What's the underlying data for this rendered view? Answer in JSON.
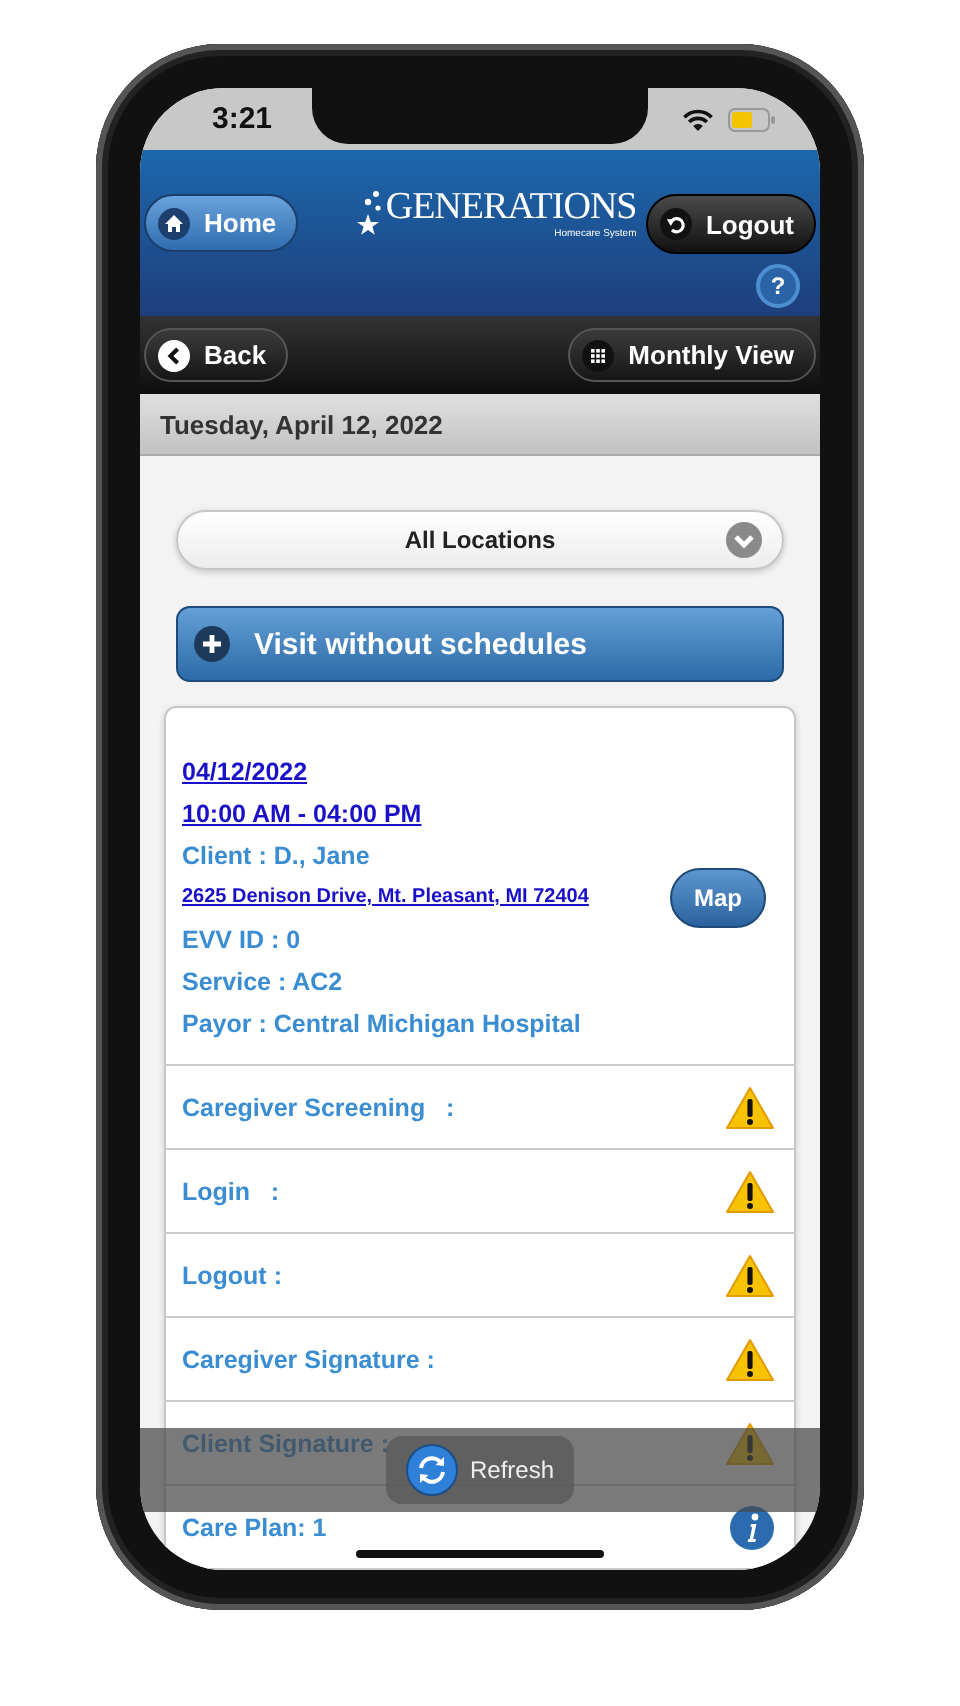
{
  "status_bar": {
    "time": "3:21"
  },
  "header": {
    "home_button": "Home",
    "logo": {
      "name": "GENERATIONS",
      "tagline": "Homecare System"
    },
    "logout_button": "Logout",
    "help_button": "?"
  },
  "toolbar": {
    "back_button": "Back",
    "monthly_view_button": "Monthly View"
  },
  "date_bar": "Tuesday, April 12, 2022",
  "location_select": {
    "value": "All Locations"
  },
  "visit_button": "Visit without schedules",
  "visit_card": {
    "date": "04/12/2022",
    "time": "10:00 AM - 04:00 PM",
    "client": "Client : D., Jane",
    "address": "2625 Denison Drive, Mt. Pleasant, MI 72404",
    "evv_id": "EVV ID : 0",
    "service": "Service : AC2",
    "payor": "Payor : Central Michigan Hospital",
    "map_button": "Map",
    "rows": [
      {
        "label": "Caregiver Screening   :",
        "kind": "warning"
      },
      {
        "label": "Login   :",
        "kind": "warning"
      },
      {
        "label": "Logout :",
        "kind": "warning"
      },
      {
        "label": "Caregiver Signature :",
        "kind": "warning"
      },
      {
        "label": "Client Signature :",
        "kind": "warning"
      },
      {
        "label": "Care Plan: 1",
        "kind": "info"
      }
    ]
  },
  "refresh_toast": {
    "label": "Refresh"
  }
}
